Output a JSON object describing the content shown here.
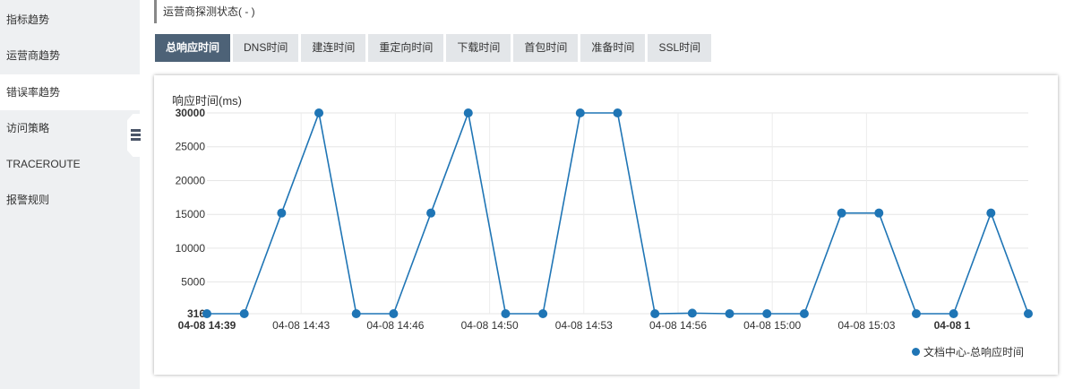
{
  "sidebar": {
    "items": [
      {
        "label": "指标趋势",
        "active": false
      },
      {
        "label": "运营商趋势",
        "active": false
      },
      {
        "label": "错误率趋势",
        "active": true
      },
      {
        "label": "访问策略",
        "active": false
      },
      {
        "label": "TRACEROUTE",
        "active": false
      },
      {
        "label": "报警规则",
        "active": false
      }
    ]
  },
  "status": {
    "label": "运营商探测状态( - )"
  },
  "tabs": [
    {
      "label": "总响应时间",
      "active": true
    },
    {
      "label": "DNS时间",
      "active": false
    },
    {
      "label": "建连时间",
      "active": false
    },
    {
      "label": "重定向时间",
      "active": false
    },
    {
      "label": "下载时间",
      "active": false
    },
    {
      "label": "首包时间",
      "active": false
    },
    {
      "label": "准备时间",
      "active": false
    },
    {
      "label": "SSL时间",
      "active": false
    }
  ],
  "colors": {
    "series": "#1f75b5",
    "tab_active": "#4d6277",
    "tab_inactive": "#e3e6e9",
    "sidebar": "#eef0f2"
  },
  "chart_data": {
    "type": "line",
    "ylabel": "响应时间(ms)",
    "ylim": [
      316,
      30000
    ],
    "yticks": [
      "316",
      "5000",
      "10000",
      "15000",
      "20000",
      "25000",
      "30000"
    ],
    "xticks": [
      "04-08 14:39",
      "04-08 14:43",
      "04-08 14:46",
      "04-08 14:50",
      "04-08 14:53",
      "04-08 14:56",
      "04-08 15:00",
      "04-08 15:03",
      "04-08 1"
    ],
    "grid": true,
    "legend_position": "bottom-right",
    "series": [
      {
        "name": "文档中心-总响应时间",
        "values": [
          316,
          316,
          15200,
          30000,
          316,
          316,
          15200,
          30000,
          316,
          316,
          30000,
          30000,
          316,
          400,
          316,
          316,
          316,
          15200,
          15200,
          316,
          316,
          15200,
          316
        ]
      }
    ]
  }
}
